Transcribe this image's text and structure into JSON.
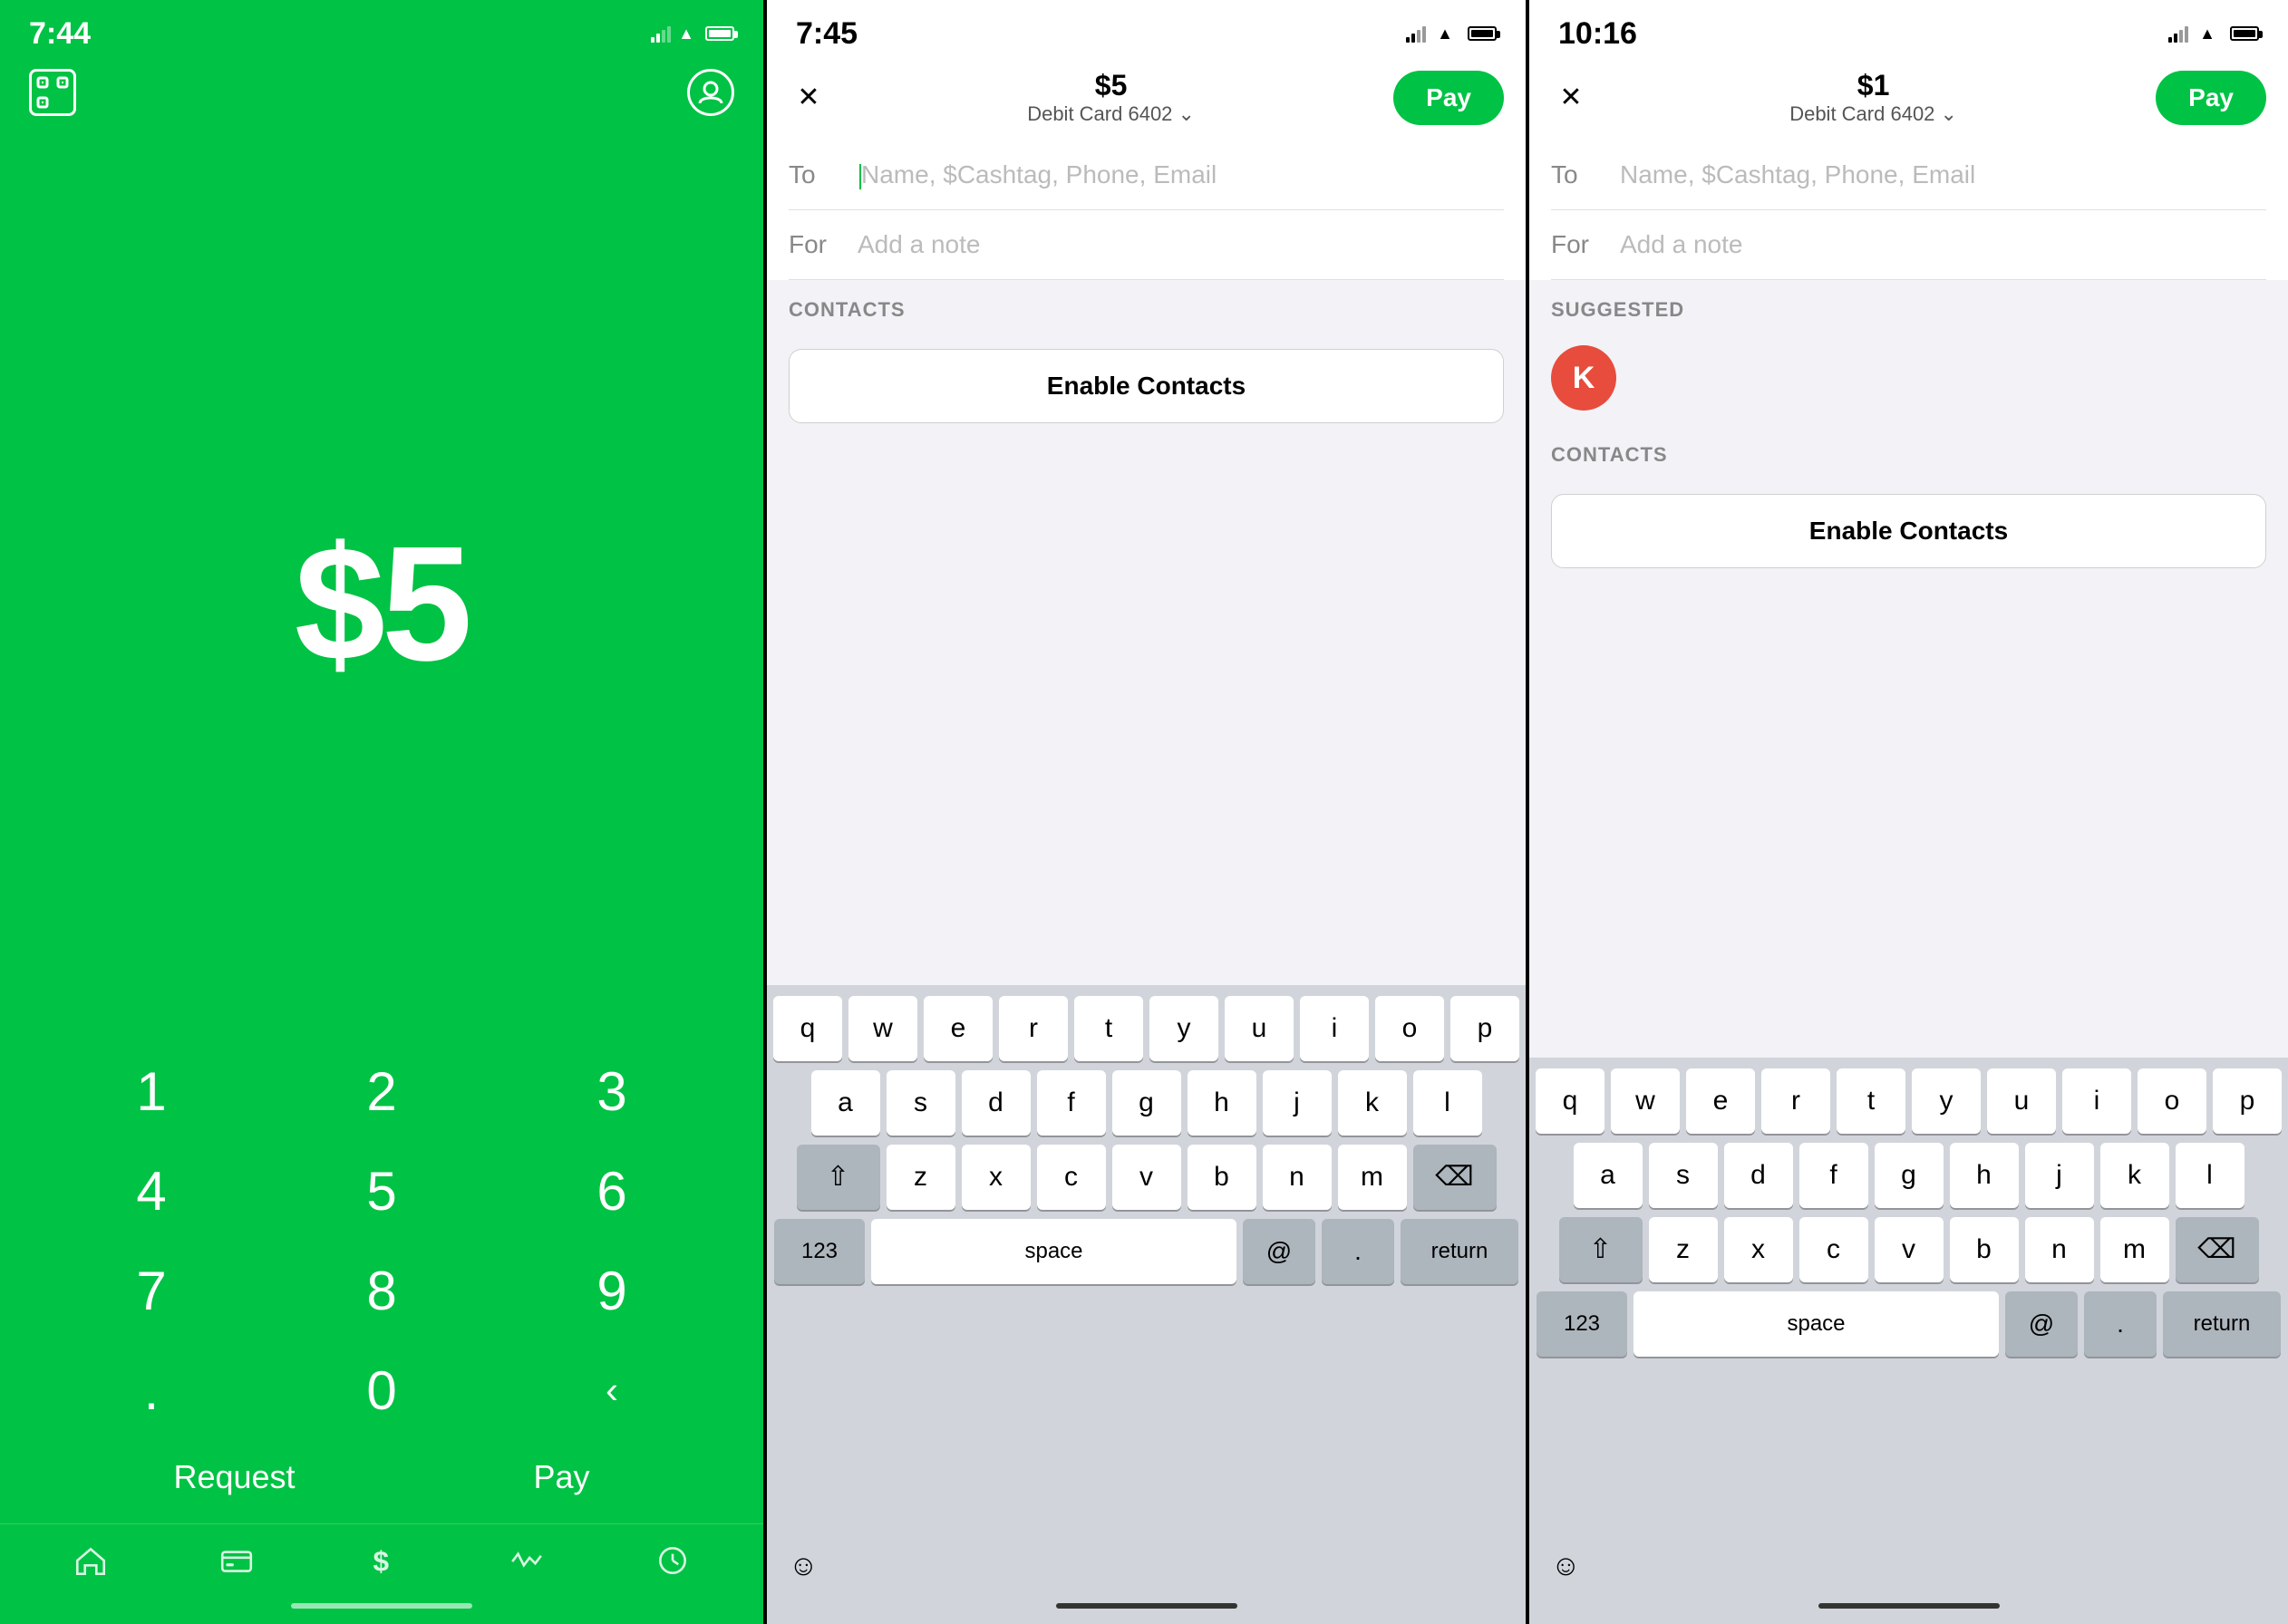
{
  "panel1": {
    "status": {
      "time": "7:44"
    },
    "amount": "$5",
    "numpad": {
      "keys": [
        "1",
        "2",
        "3",
        "4",
        "5",
        "6",
        "7",
        "8",
        "9",
        ".",
        "0",
        "⌫"
      ]
    },
    "actions": {
      "request": "Request",
      "pay": "Pay"
    },
    "nav": {
      "items": [
        "home",
        "card",
        "dollar",
        "activity",
        "clock"
      ]
    }
  },
  "panel2": {
    "status": {
      "time": "7:45"
    },
    "header": {
      "amount": "$5",
      "card": "Debit Card 6402 ⌄",
      "pay_label": "Pay"
    },
    "form": {
      "to_label": "To",
      "to_placeholder": "Name, $Cashtag, Phone, Email",
      "for_label": "For",
      "for_placeholder": "Add a note"
    },
    "contacts_section": "CONTACTS",
    "enable_contacts": "Enable Contacts",
    "keyboard": {
      "row1": [
        "q",
        "w",
        "e",
        "r",
        "t",
        "y",
        "u",
        "i",
        "o",
        "p"
      ],
      "row2": [
        "a",
        "s",
        "d",
        "f",
        "g",
        "h",
        "j",
        "k",
        "l"
      ],
      "row3": [
        "z",
        "x",
        "c",
        "v",
        "b",
        "n",
        "m"
      ],
      "num_label": "123",
      "space_label": "space",
      "at_label": "@",
      "dot_label": ".",
      "return_label": "return"
    }
  },
  "panel3": {
    "status": {
      "time": "10:16"
    },
    "header": {
      "amount": "$1",
      "card": "Debit Card 6402 ⌄",
      "pay_label": "Pay"
    },
    "form": {
      "to_label": "To",
      "to_placeholder": "Name, $Cashtag, Phone, Email",
      "for_label": "For",
      "for_placeholder": "Add a note"
    },
    "suggested_section": "SUGGESTED",
    "suggested_avatar": "K",
    "contacts_section": "CONTACTS",
    "enable_contacts": "Enable Contacts",
    "keyboard": {
      "row1": [
        "q",
        "w",
        "e",
        "r",
        "t",
        "y",
        "u",
        "i",
        "o",
        "p"
      ],
      "row2": [
        "a",
        "s",
        "d",
        "f",
        "g",
        "h",
        "j",
        "k",
        "l"
      ],
      "row3": [
        "z",
        "x",
        "c",
        "v",
        "b",
        "n",
        "m"
      ],
      "num_label": "123",
      "space_label": "space",
      "at_label": "@",
      "dot_label": ".",
      "return_label": "return"
    }
  }
}
